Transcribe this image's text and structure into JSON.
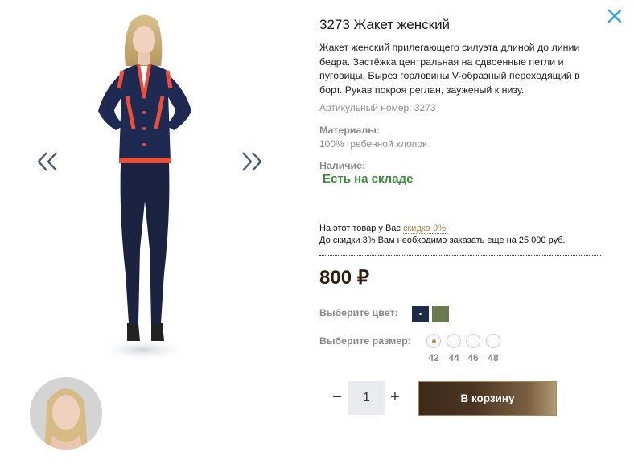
{
  "product": {
    "title": "3273 Жакет женский",
    "description": "Жакет женский прилегающего силуэта длиной до линии бедра. Застёжка центральная на сдвоенные петли и пуговицы. Вырез горловины V-образный переходящий в борт. Рукав покроя реглан, зауженый к низу.",
    "article": "Артикульный номер: 3273",
    "materials_label": "Материалы:",
    "materials_value": "100% гребенной хлопок",
    "stock_label": "Наличие:",
    "stock_value": "Есть на складе"
  },
  "discount": {
    "prefix": "На этот товар у Вас ",
    "link": "скидка 0%",
    "note": "До скидки 3% Вам необходимо заказать еще на 25 000 руб."
  },
  "price": "800 ₽",
  "color": {
    "label": "Выберите цвет:",
    "swatches": [
      "#1d2b49",
      "#6b7a50"
    ],
    "selected": 0
  },
  "size": {
    "label": "Выберите размер:",
    "options": [
      "42",
      "44",
      "46",
      "48"
    ],
    "selected": "42"
  },
  "quantity": {
    "minus": "−",
    "value": "1",
    "plus": "+"
  },
  "cart_button": "В корзину",
  "icons": {
    "close": "close-icon",
    "prev": "chevron-double-left-icon",
    "next": "chevron-double-right-icon"
  },
  "colors": {
    "accent": "#3aa5e0",
    "in_stock": "#3b8e3b",
    "price": "#2e1f10",
    "discount_link": "#b0834e"
  }
}
